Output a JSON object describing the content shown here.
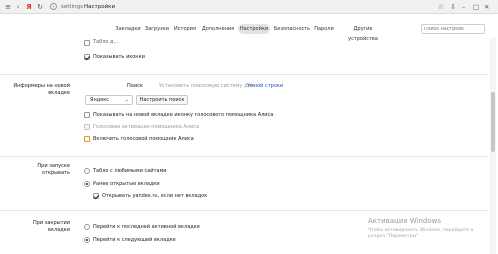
{
  "browser": {
    "url_host": "settings",
    "url_title": "Настройки",
    "colors": {
      "link": "#1a55b8",
      "watermark": "#9a9a9a"
    }
  },
  "tabs": [
    {
      "label": "Закладки",
      "active": false
    },
    {
      "label": "Загрузки",
      "active": false
    },
    {
      "label": "История",
      "active": false
    },
    {
      "label": "Дополнения",
      "active": false
    },
    {
      "label": "Настройки",
      "active": true
    },
    {
      "label": "Безопасность",
      "active": false
    },
    {
      "label": "Пароли",
      "active": false
    },
    {
      "label": "Другие устройства",
      "active": false
    }
  ],
  "search": {
    "placeholder": "Поиск настроек"
  },
  "top_section": {
    "partial_label": "Табло д...",
    "show_icons_label": "Показывать иконки"
  },
  "informers": {
    "section_label": "Информеры на новой вкладке",
    "search_title": "Поиск",
    "search_hint": "Установить поисковую систему для",
    "smart_line_link": "Умной строки",
    "engine_value": "Яндекс",
    "configure_button": "Настроить поиск",
    "show_alice_icon": "Показывать на новой вкладке иконку голосового помощника Алиса",
    "voice_activation": "Голосовая активация помощника Алиса",
    "enable_alice": "Включить голосовой помощник Алиса"
  },
  "startup": {
    "section_label": "При запуске открывать",
    "option_favorites": "Табло с любимыми сайтами",
    "option_previous": "Ранее открытые вкладки",
    "open_yandex_if_none": "Открывать yandex.ru, если нет вкладок"
  },
  "on_close": {
    "section_label": "При закрытии вкладки",
    "option_last_active": "Перейти к последней активной вкладке",
    "option_next": "Перейти к следующей вкладке"
  },
  "watermark": {
    "title": "Активация Windows",
    "subtitle": "Чтобы активировать Windows, перейдите в раздел \"Параметры\"."
  }
}
